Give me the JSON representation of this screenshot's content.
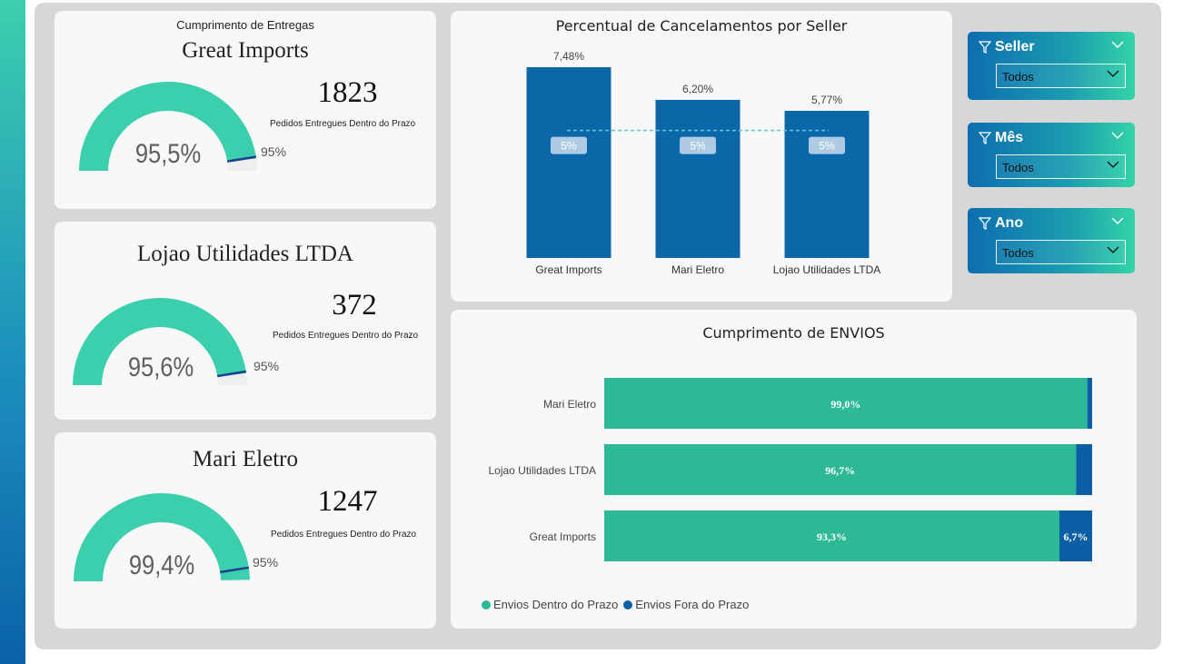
{
  "colors": {
    "gauge": "#3ccfae",
    "target": "#1a3f94",
    "bar": "#0b67a8",
    "stack_in": "#2db896",
    "stack_out": "#0b5fa5"
  },
  "gauges": [
    {
      "header": "Cumprimento de Entregas",
      "seller": "Great Imports",
      "count": "1823",
      "count_label": "Pedidos Entregues Dentro do Prazo",
      "pct_label": "95,5%",
      "value": 95.5,
      "target": 95,
      "target_label": "95%"
    },
    {
      "header": "",
      "seller": "Lojao Utilidades LTDA",
      "count": "372",
      "count_label": "Pedidos Entregues Dentro do Prazo",
      "pct_label": "95,6%",
      "value": 95.6,
      "target": 95,
      "target_label": "95%"
    },
    {
      "header": "",
      "seller": "Mari Eletro",
      "count": "1247",
      "count_label": "Pedidos Entregues Dentro do Prazo",
      "pct_label": "99,4%",
      "value": 99.4,
      "target": 95,
      "target_label": "95%"
    }
  ],
  "chart_data": [
    {
      "type": "bar",
      "title": "Percentual de Cancelamentos por Seller",
      "categories": [
        "Great Imports",
        "Mari Eletro",
        "Lojao Utilidades LTDA"
      ],
      "values": [
        7.48,
        6.2,
        5.77
      ],
      "value_labels": [
        "7,48%",
        "6,20%",
        "5,77%"
      ],
      "reference_value": 5,
      "reference_label": "5%",
      "ylim": [
        0,
        7.48
      ]
    },
    {
      "type": "bar",
      "orientation": "horizontal-stacked-100",
      "title": "Cumprimento de ENVIOS",
      "categories": [
        "Mari Eletro",
        "Lojao Utilidades LTDA",
        "Great Imports"
      ],
      "series": [
        {
          "name": "Envios Dentro do Prazo",
          "values": [
            99.0,
            96.7,
            93.3
          ],
          "labels": [
            "99,0%",
            "96,7%",
            "93,3%"
          ]
        },
        {
          "name": "Envios Fora do Prazo",
          "values": [
            1.0,
            3.3,
            6.7
          ],
          "labels": [
            "",
            "",
            "6,7%"
          ]
        }
      ],
      "legend": "bottom-left"
    }
  ],
  "slicers": [
    {
      "title": "Seller",
      "value": "Todos"
    },
    {
      "title": "Mês",
      "value": "Todos"
    },
    {
      "title": "Ano",
      "value": "Todos"
    }
  ]
}
